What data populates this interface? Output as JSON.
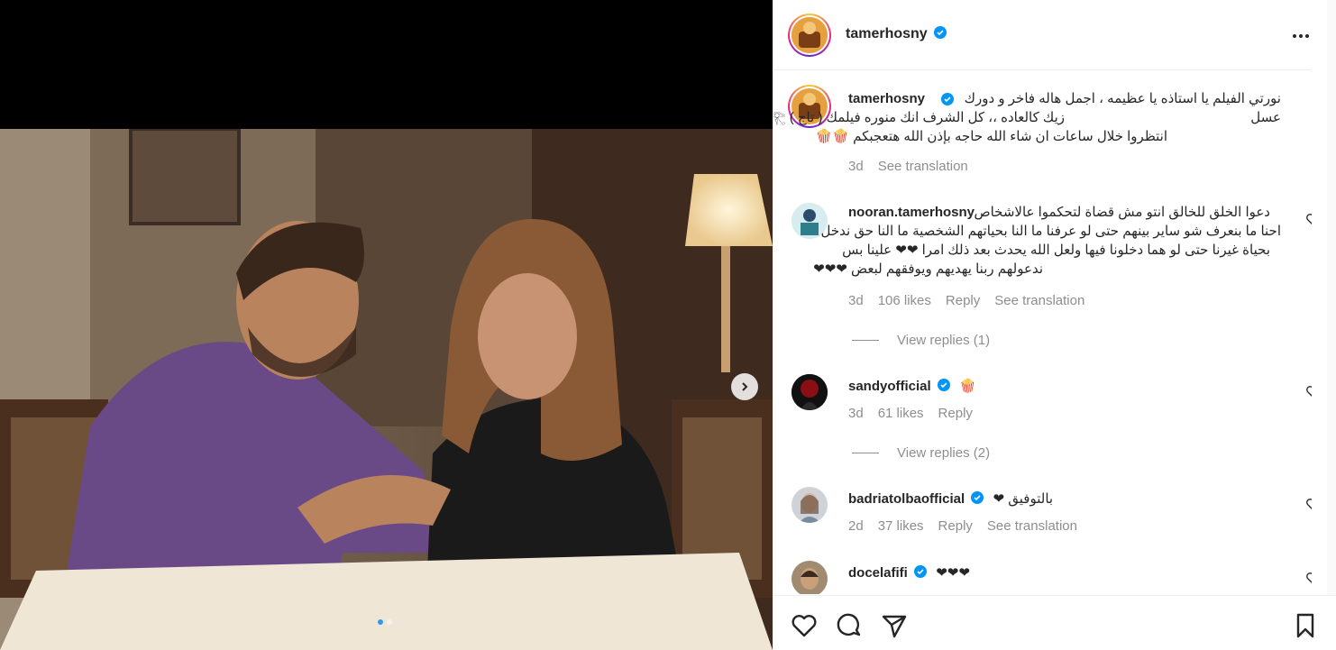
{
  "post": {
    "author": "tamerhosny",
    "caption_lines": [
      "نورتي الفيلم يا استاذه يا عظيمه ، اجمل هاله فاخر و دورك عسل",
      "زيك كالعاده ،، كل الشرف انك منوره فيلمك ( تاج ) 𓂀",
      "انتظروا خلال ساعات ان شاء الله حاجه بإذن الله هتعجبكم 🍿🍿"
    ],
    "caption_age": "3d",
    "see_translation": "See translation"
  },
  "comments": [
    {
      "username": "nooran.tamerhosny",
      "lines": [
        "دعوا الخلق للخالق انتو مش قضاة لتحكموا عالاشخاص",
        "احنا ما بنعرف شو ساير بينهم حتى لو عرفنا ما النا بحياتهم الشخصية ما النا حق ندخل",
        "بحياة غيرنا حتى لو هما دخلونا فيها ولعل الله يحدث بعد ذلك امرا ❤❤ علينا بس",
        "ندعولهم ربنا يهديهم ويوفقهم لبعض ❤❤❤"
      ],
      "age": "3d",
      "likes": "106 likes",
      "reply": "Reply",
      "see_translation": "See translation",
      "view_replies": "View replies (1)"
    },
    {
      "username": "sandyofficial",
      "text": "🍿",
      "age": "3d",
      "likes": "61 likes",
      "reply": "Reply",
      "view_replies": "View replies (2)"
    },
    {
      "username": "badriatolbaofficial",
      "text": "بالتوفيق ❤",
      "age": "2d",
      "likes": "37 likes",
      "reply": "Reply",
      "see_translation": "See translation"
    },
    {
      "username": "docelafifi",
      "text": "❤❤❤"
    }
  ],
  "icons": [
    "heart-icon",
    "comment-icon",
    "share-icon",
    "bookmark-icon",
    "more-icon",
    "verified-badge-icon",
    "chevron-right-icon"
  ],
  "colors": {
    "verified": "#0095f6",
    "muted": "#8e8e8e",
    "text": "#262626",
    "accent_dot": "#2a9bf5"
  }
}
